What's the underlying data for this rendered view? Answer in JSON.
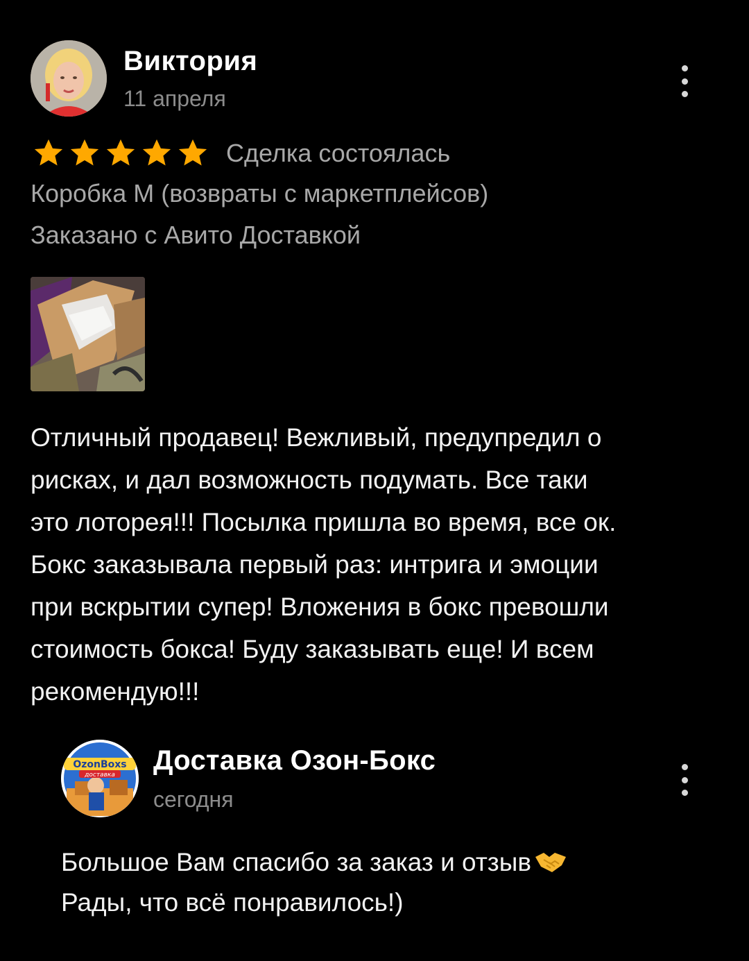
{
  "review": {
    "author_name": "Виктория",
    "date": "11 апреля",
    "rating": 5,
    "rating_max": 5,
    "star_color": "#ffa800",
    "deal_status": "Сделка состоялась",
    "item_title": "Коробка М (возвраты с маркетплейсов)",
    "delivery_note": "Заказано с Авито Доставкой",
    "photo_icon": "box-photo",
    "text_lines": [
      "Отличный продавец! Вежливый, предупредил о",
      "рисках, и дал возможность подумать. Все таки",
      "это лоторея!!! Посылка пришла во время, все ок.",
      "Бокс заказывала первый раз: интрига и эмоции",
      "при вскрытии супер! Вложения в бокс превошли",
      "стоимость бокса! Буду заказывать еще! И всем",
      "рекомендую!!!"
    ]
  },
  "reply": {
    "seller_name": "Доставка Озон-Бокс",
    "date": "сегодня",
    "logo_text_top": "OzonBoxs",
    "logo_text_bottom": "доставка",
    "text_line_1": "Большое Вам спасибо за заказ и отзыв",
    "text_line_1_emoji": "handshake-icon",
    "text_line_2": "Рады, что всё понравилось!)"
  },
  "colors": {
    "background": "#000000",
    "primary_text": "#ffffff",
    "secondary_text": "#a8a8a8",
    "date_text": "#8c8c8c",
    "star": "#ffa800"
  }
}
